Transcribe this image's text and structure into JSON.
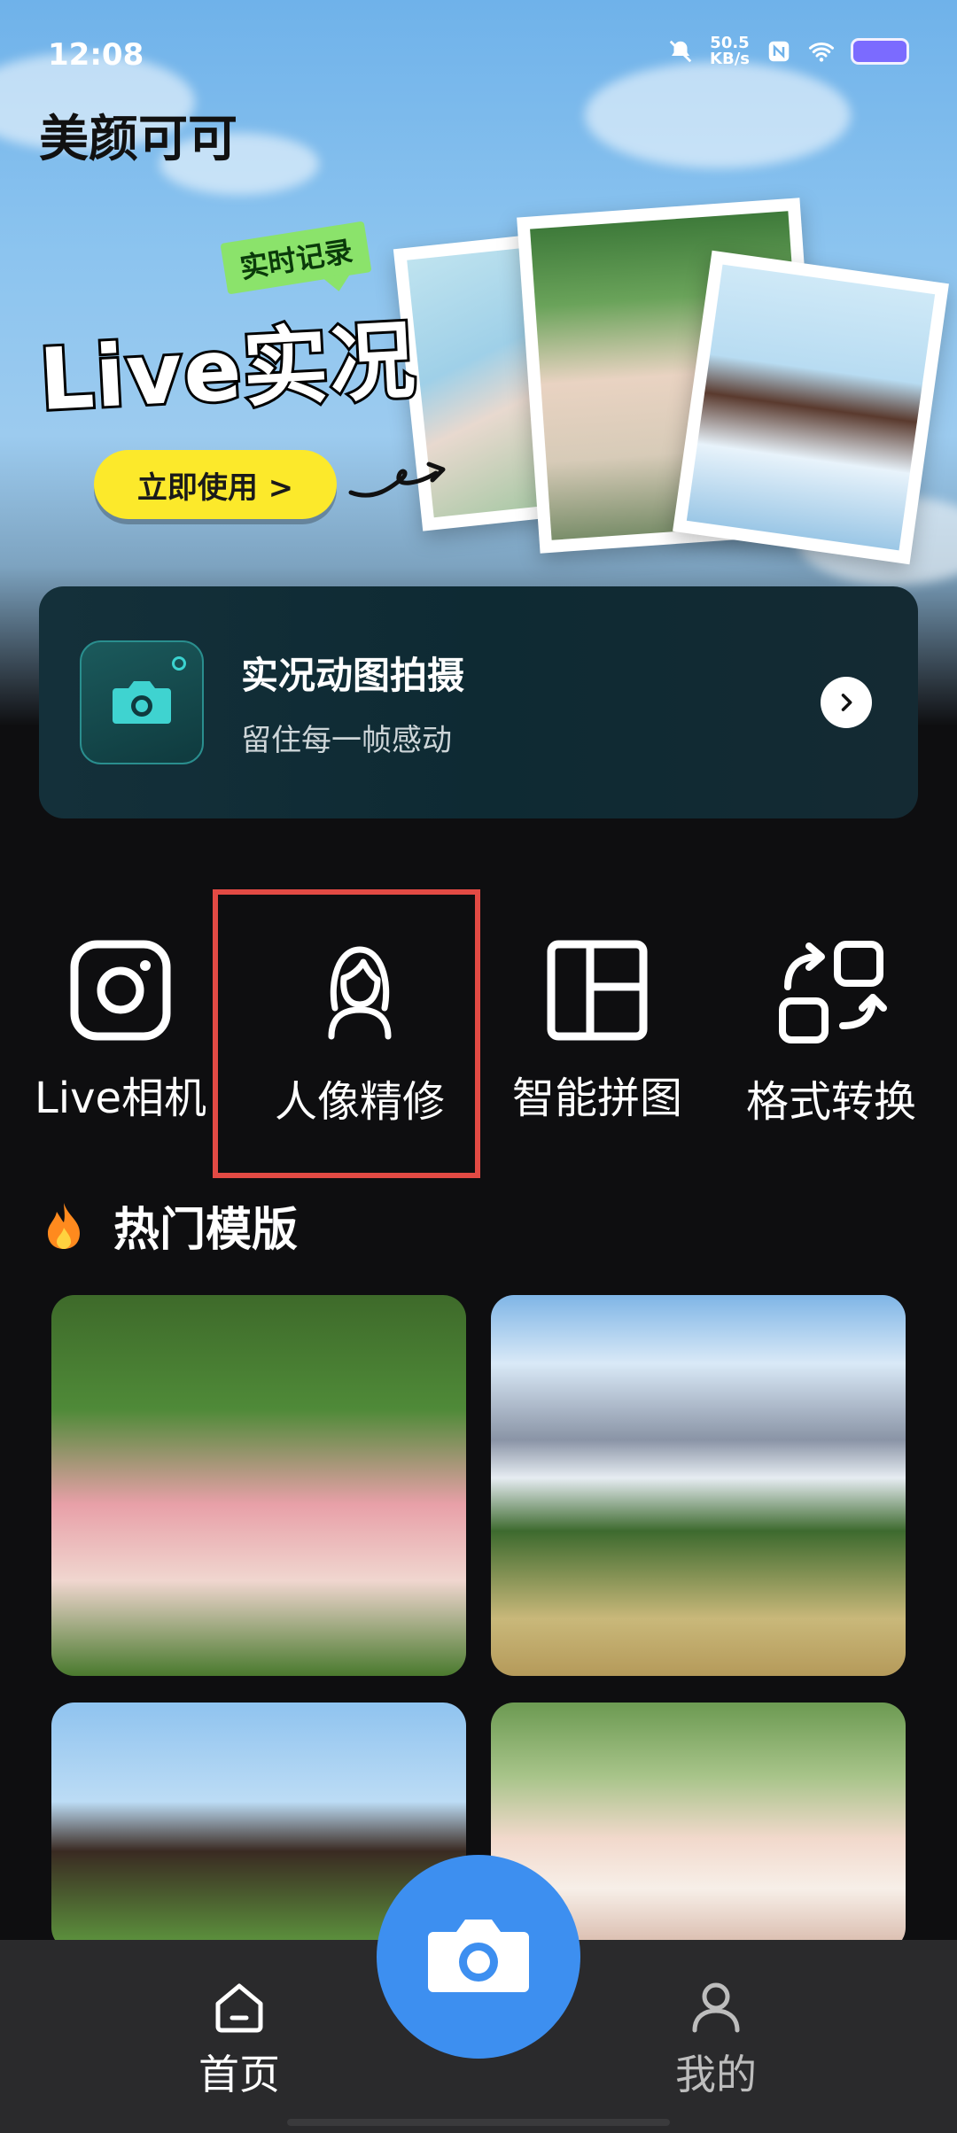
{
  "status_bar": {
    "time": "12:08",
    "net_speed_value": "50.5",
    "net_speed_unit": "KB/s",
    "icons": [
      "mute-bell-icon",
      "nfc-icon",
      "wifi-icon",
      "battery-icon"
    ]
  },
  "header": {
    "app_title": "美颜可可"
  },
  "banner": {
    "tag": "实时记录",
    "title": "Live实况",
    "cta_label": "立即使用 >"
  },
  "feature_card": {
    "title": "实况动图拍摄",
    "subtitle": "留住每一帧感动",
    "icon": "camera-icon",
    "arrow_icon": "chevron-right-icon"
  },
  "tools": [
    {
      "label": "Live相机",
      "icon": "instagram-camera-icon"
    },
    {
      "label": "人像精修",
      "icon": "portrait-woman-icon"
    },
    {
      "label": "智能拼图",
      "icon": "collage-grid-icon"
    },
    {
      "label": "格式转换",
      "icon": "convert-shapes-icon"
    }
  ],
  "templates_section": {
    "title": "热门模版",
    "icon": "fire-icon"
  },
  "bottom_nav": {
    "home_label": "首页",
    "me_label": "我的",
    "fab_icon": "camera-icon"
  },
  "colors": {
    "accent_blue": "#3d8ff0",
    "cta_yellow": "#fce92b",
    "highlight_red": "#e24a44",
    "background": "#0e0e10",
    "nav_bg": "#2a2a2c"
  }
}
